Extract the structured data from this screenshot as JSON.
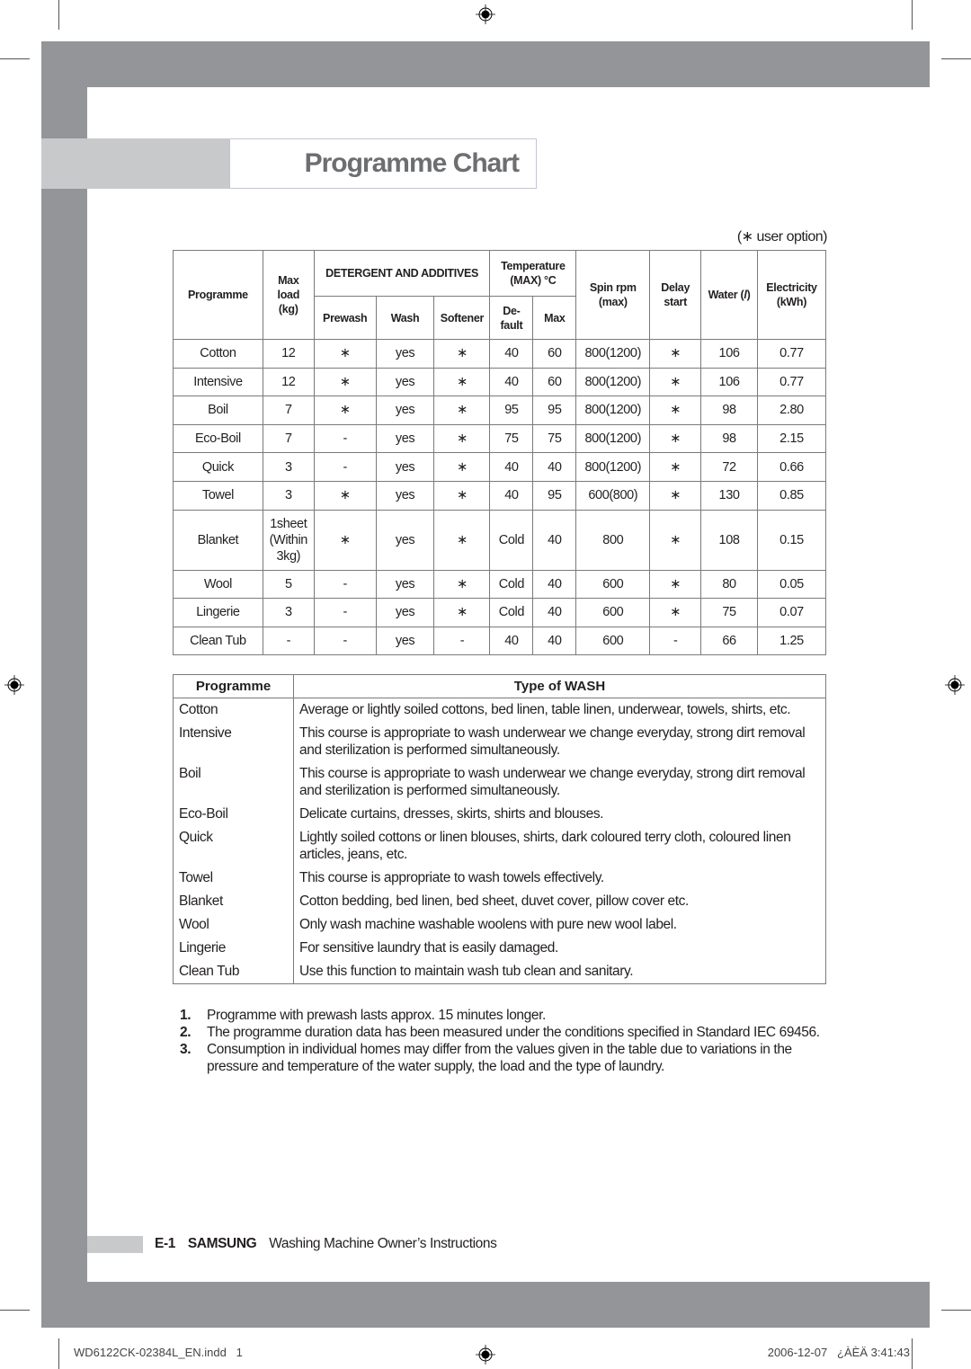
{
  "page": {
    "title": "Programme Chart",
    "user_option_note": "(∗ user option)"
  },
  "programme_table": {
    "headers": {
      "programme": "Programme",
      "max_load": "Max load (kg)",
      "detergent_group": "DETERGENT AND ADDITIVES",
      "prewash": "Prewash",
      "wash": "Wash",
      "softener": "Softener",
      "temperature_group": "Temperature (MAX) °C",
      "default": "De-fault",
      "max": "Max",
      "spin_rpm": "Spin rpm (max)",
      "delay_start": "Delay start",
      "water": "Water (l)",
      "electricity": "Electricity (kWh)"
    },
    "rows": [
      {
        "programme": "Cotton",
        "max_load": "12",
        "prewash": "∗",
        "wash": "yes",
        "softener": "∗",
        "temp_default": "40",
        "temp_max": "60",
        "spin": "800(1200)",
        "delay": "∗",
        "water": "106",
        "electricity": "0.77"
      },
      {
        "programme": "Intensive",
        "max_load": "12",
        "prewash": "∗",
        "wash": "yes",
        "softener": "∗",
        "temp_default": "40",
        "temp_max": "60",
        "spin": "800(1200)",
        "delay": "∗",
        "water": "106",
        "electricity": "0.77"
      },
      {
        "programme": "Boil",
        "max_load": "7",
        "prewash": "∗",
        "wash": "yes",
        "softener": "∗",
        "temp_default": "95",
        "temp_max": "95",
        "spin": "800(1200)",
        "delay": "∗",
        "water": "98",
        "electricity": "2.80"
      },
      {
        "programme": "Eco-Boil",
        "max_load": "7",
        "prewash": "-",
        "wash": "yes",
        "softener": "∗",
        "temp_default": "75",
        "temp_max": "75",
        "spin": "800(1200)",
        "delay": "∗",
        "water": "98",
        "electricity": "2.15"
      },
      {
        "programme": "Quick",
        "max_load": "3",
        "prewash": "-",
        "wash": "yes",
        "softener": "∗",
        "temp_default": "40",
        "temp_max": "40",
        "spin": "800(1200)",
        "delay": "∗",
        "water": "72",
        "electricity": "0.66"
      },
      {
        "programme": "Towel",
        "max_load": "3",
        "prewash": "∗",
        "wash": "yes",
        "softener": "∗",
        "temp_default": "40",
        "temp_max": "95",
        "spin": "600(800)",
        "delay": "∗",
        "water": "130",
        "electricity": "0.85"
      },
      {
        "programme": "Blanket",
        "max_load_lines": [
          "1sheet",
          "(Within",
          "3kg)"
        ],
        "prewash": "∗",
        "wash": "yes",
        "softener": "∗",
        "temp_default": "Cold",
        "temp_max": "40",
        "spin": "800",
        "delay": "∗",
        "water": "108",
        "electricity": "0.15"
      },
      {
        "programme": "Wool",
        "max_load": "5",
        "prewash": "-",
        "wash": "yes",
        "softener": "∗",
        "temp_default": "Cold",
        "temp_max": "40",
        "spin": "600",
        "delay": "∗",
        "water": "80",
        "electricity": "0.05"
      },
      {
        "programme": "Lingerie",
        "max_load": "3",
        "prewash": "-",
        "wash": "yes",
        "softener": "∗",
        "temp_default": "Cold",
        "temp_max": "40",
        "spin": "600",
        "delay": "∗",
        "water": "75",
        "electricity": "0.07"
      },
      {
        "programme": "Clean Tub",
        "max_load": "-",
        "prewash": "-",
        "wash": "yes",
        "softener": "-",
        "temp_default": "40",
        "temp_max": "40",
        "spin": "600",
        "delay": "-",
        "water": "66",
        "electricity": "1.25"
      }
    ]
  },
  "wash_types": {
    "headers": {
      "programme": "Programme",
      "type": "Type of WASH"
    },
    "rows": [
      {
        "programme": "Cotton",
        "description": "Average or lightly soiled cottons, bed linen, table linen, underwear, towels, shirts, etc."
      },
      {
        "programme": "Intensive",
        "description": "This course is appropriate to wash underwear we change everyday, strong dirt removal and sterilization is performed simultaneously."
      },
      {
        "programme": "Boil",
        "description": "This course is appropriate to wash underwear we change everyday, strong dirt removal and sterilization is performed simultaneously."
      },
      {
        "programme": "Eco-Boil",
        "description": "Delicate curtains, dresses, skirts, shirts and blouses."
      },
      {
        "programme": "Quick",
        "description": "Lightly soiled cottons or linen blouses, shirts, dark coloured terry cloth, coloured linen articles, jeans, etc."
      },
      {
        "programme": "Towel",
        "description": "This course is appropriate to wash towels effectively."
      },
      {
        "programme": "Blanket",
        "description": "Cotton bedding, bed linen, bed sheet, duvet cover, pillow cover etc."
      },
      {
        "programme": "Wool",
        "description": "Only wash machine washable woolens with pure new wool label."
      },
      {
        "programme": "Lingerie",
        "description": "For sensitive laundry that is easily damaged."
      },
      {
        "programme": "Clean Tub",
        "description": "Use this function to maintain wash tub clean and sanitary."
      }
    ]
  },
  "notes": [
    {
      "num": "1.",
      "text": "Programme with prewash lasts approx. 15 minutes longer."
    },
    {
      "num": "2.",
      "text": "The programme duration data has been measured under the conditions specified in Standard IEC 69456."
    },
    {
      "num": "3.",
      "text": "Consumption in individual homes may differ from the values given in the table due to variations in the pressure and temperature of the water supply, the load and the type of laundry."
    }
  ],
  "footer": {
    "page_number": "E-1",
    "brand": "SAMSUNG",
    "doc_title": "Washing Machine Owner’s Instructions"
  },
  "print_slug": {
    "file": "WD6122CK-02384L_EN.indd   1",
    "timestamp": "2006-12-07   ¿ÀÈÄ 3:41:43"
  },
  "colors": {
    "frame_gray": "#939598",
    "light_gray": "#c8c9cb",
    "title_text": "#6d6e71"
  }
}
